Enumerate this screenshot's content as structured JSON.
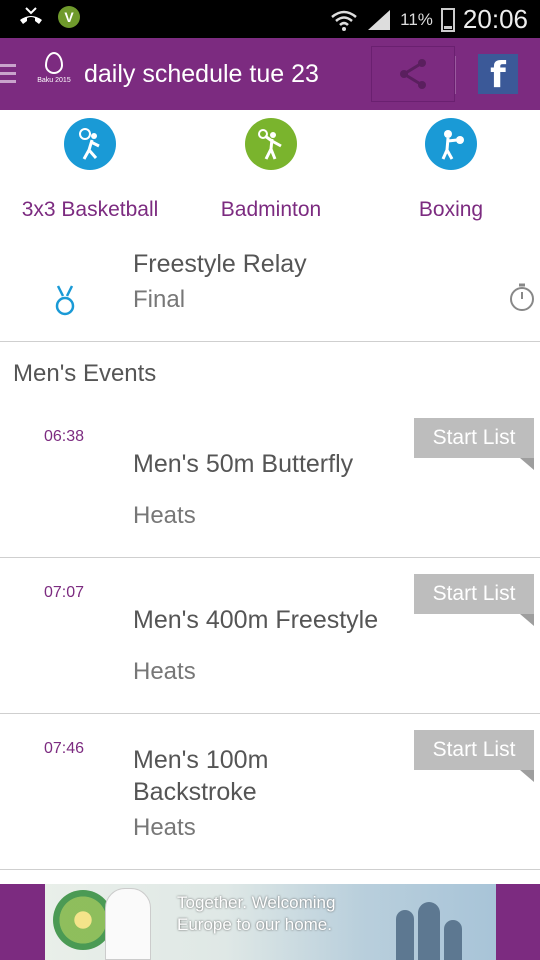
{
  "status_bar": {
    "battery_percent": "11%",
    "time": "20:06",
    "app_badge": "V"
  },
  "app_bar": {
    "logo_text": "Baku 2015",
    "title": "daily schedule tue 23"
  },
  "sports": [
    {
      "label": "3x3 Basketball",
      "icon": "basketball-icon",
      "color": "#1a9ad6"
    },
    {
      "label": "Badminton",
      "icon": "badminton-icon",
      "color": "#7ab42d"
    },
    {
      "label": "Boxing",
      "icon": "boxing-icon",
      "color": "#1a9ad6"
    }
  ],
  "relay": {
    "name": "Freestyle Relay",
    "phase": "Final"
  },
  "section_title": "Men's Events",
  "events": [
    {
      "time": "06:38",
      "name": "Men's 50m Butterfly",
      "phase": "Heats",
      "button": "Start List"
    },
    {
      "time": "07:07",
      "name": "Men's 400m Freestyle",
      "phase": "Heats",
      "button": "Start List"
    },
    {
      "time": "07:46",
      "name": "Men's 100m\nBackstroke",
      "phase": "Heats",
      "button": "Start List"
    }
  ],
  "banner": {
    "tagline_line1": "Together. Welcoming",
    "tagline_line2": "Europe to our home."
  },
  "colors": {
    "brand_purple": "#7c2b80",
    "accent_blue": "#1a9ad6",
    "accent_green": "#7ab42d"
  }
}
